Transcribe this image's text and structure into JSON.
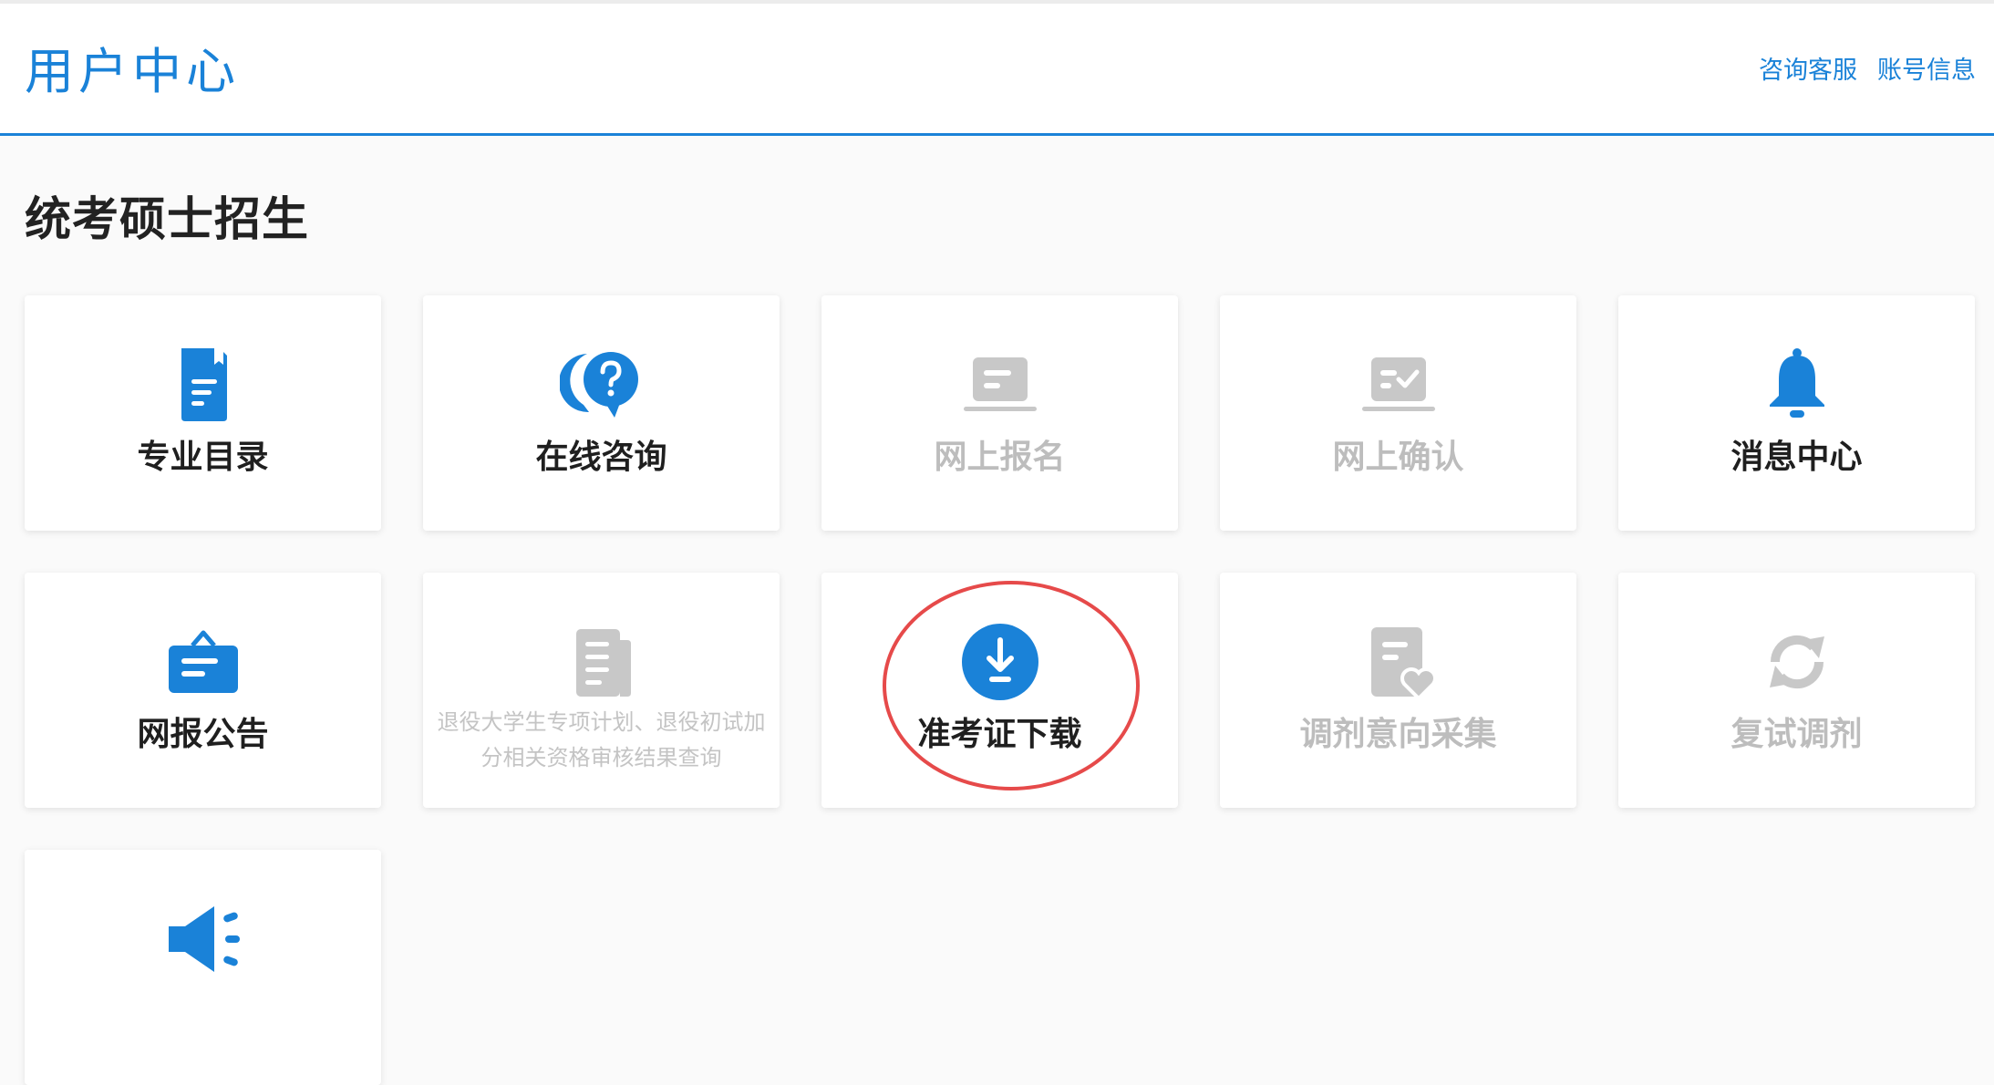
{
  "header": {
    "title": "用户中心",
    "links": [
      "咨询客服",
      "账号信息"
    ],
    "accent_color": "#1a82d8"
  },
  "section": {
    "title": "统考硕士招生"
  },
  "cards": [
    {
      "label": "专业目录",
      "icon": "document-icon",
      "enabled": true
    },
    {
      "label": "在线咨询",
      "icon": "question-chat-icon",
      "enabled": true
    },
    {
      "label": "网上报名",
      "icon": "laptop-form-icon",
      "enabled": false
    },
    {
      "label": "网上确认",
      "icon": "laptop-check-icon",
      "enabled": false
    },
    {
      "label": "消息中心",
      "icon": "bell-icon",
      "enabled": true
    },
    {
      "label": "网报公告",
      "icon": "notice-board-icon",
      "enabled": true
    },
    {
      "label": "退役大学生专项计划、退役初试加分相关资格审核结果查询",
      "icon": "newspaper-icon",
      "enabled": false
    },
    {
      "label": "准考证下载",
      "icon": "download-icon",
      "enabled": true
    },
    {
      "label": "调剂意向采集",
      "icon": "document-heart-icon",
      "enabled": false
    },
    {
      "label": "复试调剂",
      "icon": "refresh-icon",
      "enabled": false
    },
    {
      "label": "",
      "icon": "megaphone-icon",
      "enabled": true
    }
  ],
  "colors": {
    "active_icon": "#1a82d8",
    "disabled_icon": "#c8c8c8",
    "highlight_ring": "#e64a4a"
  }
}
